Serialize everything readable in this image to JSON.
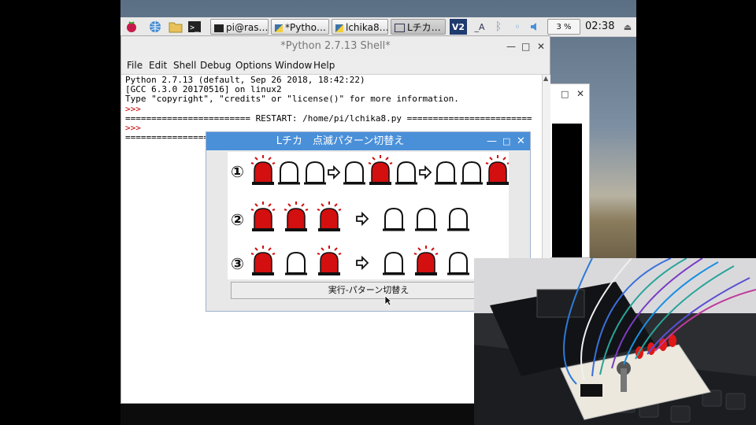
{
  "taskbar": {
    "buttons": [
      "pi@ras…",
      "*Pytho…",
      "lchika8…",
      "Lチカ…"
    ],
    "cpu": "3 %",
    "clock": "02:38"
  },
  "shell": {
    "title": "*Python 2.7.13 Shell*",
    "menu": [
      "File",
      "Edit",
      "Shell",
      "Debug",
      "Options",
      "Window",
      "Help"
    ],
    "lines": [
      "Python 2.7.13 (default, Sep 26 2018, 18:42:22)",
      "[GCC 6.3.0 20170516] on linux2",
      "Type \"copyright\", \"credits\" or \"license()\" for more information.",
      ">>>",
      "======================== RESTART: /home/pi/lchika8.py ========================",
      ">>>",
      "================"
    ]
  },
  "dialog": {
    "title": "Lチカ　点滅パターン切替え",
    "rows": [
      {
        "number": "①",
        "before": [
          true,
          false,
          false
        ],
        "after1": [
          false,
          true,
          false
        ],
        "after2": [
          false,
          false,
          true
        ]
      },
      {
        "number": "②",
        "before": [
          true,
          true,
          true
        ],
        "after1": [
          false,
          false,
          false
        ]
      },
      {
        "number": "③",
        "before": [
          true,
          false,
          true
        ],
        "after1": [
          false,
          true,
          false
        ]
      }
    ],
    "button_label": "実行-パターン切替え"
  },
  "colors": {
    "lamp_on": "#d40f0f",
    "dialog_title_bg": "#4a90d9",
    "prompt": "#c00000"
  },
  "icons": {
    "raspberry": "raspberry-icon",
    "globe": "globe-icon",
    "folder": "folder-icon",
    "terminal": "terminal-icon",
    "arrow": "arrow-right-icon"
  }
}
